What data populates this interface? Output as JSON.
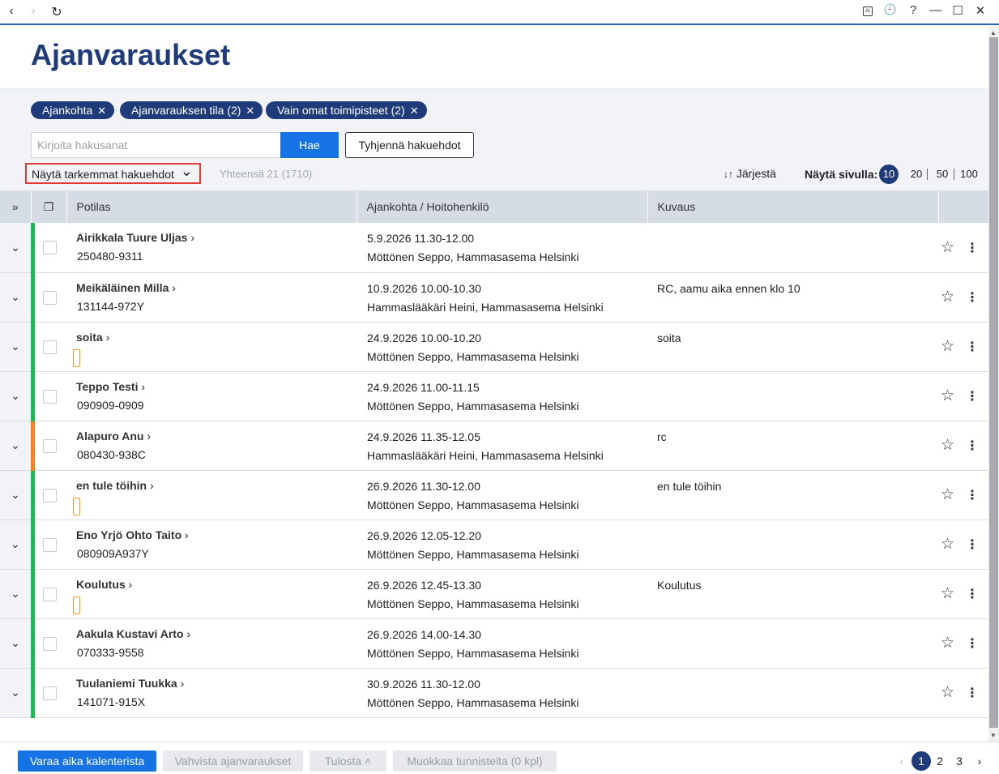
{
  "browser": {
    "back_icon": "‹",
    "forward_icon": "›",
    "reload_icon": "↻",
    "ai_icon": "AI",
    "history_icon": "🕘",
    "help_icon": "?",
    "minimize_icon": "—",
    "maximize_icon": "☐",
    "close_icon": "✕"
  },
  "page": {
    "title": "Ajanvaraukset"
  },
  "filters": {
    "chips": [
      {
        "label": "Ajankohta"
      },
      {
        "label": "Ajanvarauksen tila (2)"
      },
      {
        "label": "Vain omat toimipisteet (2)"
      }
    ],
    "chip_remove": "✕",
    "search_placeholder": "Kirjoita hakusanat",
    "search_button": "Hae",
    "clear_button": "Tyhjennä hakuehdot",
    "more_filters": "Näytä tarkemmat hakuehdot",
    "more_filters_icon": "⌄",
    "total": "Yhteensä 21 (1710)",
    "sort_icon": "↓↑",
    "sort_label": "Järjestä",
    "per_page_label": "Näytä sivulla:",
    "per_page_options": [
      "10",
      "20",
      "50",
      "100"
    ],
    "per_page_selected": "10"
  },
  "table": {
    "expand_all_icon": "»",
    "select_all_icon": "❐",
    "columns": [
      "Potilas",
      "Ajankohta / Hoitohenkilö",
      "Kuvaus"
    ],
    "rows": [
      {
        "name": "Airikkala Tuure Uljas",
        "id": "250480-9311",
        "time": "5.9.2026 11.30-12.00",
        "staff": "Möttönen Seppo, Hammasasema Helsinki",
        "desc": "",
        "status_color": "#1db954",
        "flag": false
      },
      {
        "name": "Meikäläinen Milla",
        "id": "131144-972Y",
        "time": "10.9.2026 10.00-10.30",
        "staff": "Hammaslääkäri Heini, Hammasasema Helsinki",
        "desc": "RC, aamu aika ennen klo 10",
        "status_color": "#1db954",
        "flag": false
      },
      {
        "name": "soita",
        "id": "",
        "time": "24.9.2026 10.00-10.20",
        "staff": "Möttönen Seppo, Hammasasema Helsinki",
        "desc": "soita",
        "status_color": "#1db954",
        "flag": true
      },
      {
        "name": "Teppo Testi",
        "id": "090909-0909",
        "time": "24.9.2026 11.00-11.15",
        "staff": "Möttönen Seppo, Hammasasema Helsinki",
        "desc": "",
        "status_color": "#1db954",
        "flag": false
      },
      {
        "name": "Alapuro Anu",
        "id": "080430-938C",
        "time": "24.9.2026 11.35-12.05",
        "staff": "Hammaslääkäri Heini, Hammasasema Helsinki",
        "desc": "rc",
        "status_color": "#f58220",
        "flag": false
      },
      {
        "name": "en tule töihin",
        "id": "",
        "time": "26.9.2026 11.30-12.00",
        "staff": "Möttönen Seppo, Hammasasema Helsinki",
        "desc": "en tule töihin",
        "status_color": "#1db954",
        "flag": true
      },
      {
        "name": "Eno Yrjö Ohto Taito",
        "id": "080909A937Y",
        "time": "26.9.2026 12.05-12.20",
        "staff": "Möttönen Seppo, Hammasasema Helsinki",
        "desc": "",
        "status_color": "#1db954",
        "flag": false
      },
      {
        "name": "Koulutus",
        "id": "",
        "time": "26.9.2026 12.45-13.30",
        "staff": "Möttönen Seppo, Hammasasema Helsinki",
        "desc": "Koulutus",
        "status_color": "#1db954",
        "flag": true
      },
      {
        "name": "Aakula Kustavi Arto",
        "id": "070333-9558",
        "time": "26.9.2026 14.00-14.30",
        "staff": "Möttönen Seppo, Hammasasema Helsinki",
        "desc": "",
        "status_color": "#1db954",
        "flag": false
      },
      {
        "name": "Tuulaniemi Tuukka",
        "id": "141071-915X",
        "time": "30.9.2026 11.30-12.00",
        "staff": "Möttönen Seppo, Hammasasema Helsinki",
        "desc": "",
        "status_color": "#1db954",
        "flag": false
      }
    ],
    "row_chevron": "›",
    "expand_icon": "⌄",
    "star_icon": "☆",
    "menu_icon": "⋮"
  },
  "footer": {
    "buttons": [
      {
        "label": "Varaa aika kalenterista",
        "enabled": true
      },
      {
        "label": "Vahvista ajanvaraukset",
        "enabled": false
      },
      {
        "label": "Tulosta ˄",
        "enabled": false
      },
      {
        "label": "Muokkaa tunnisteita (0 kpl)",
        "enabled": false
      }
    ],
    "pages": [
      "1",
      "2",
      "3"
    ],
    "current_page": "1",
    "prev_icon": "‹",
    "next_icon": "›"
  }
}
